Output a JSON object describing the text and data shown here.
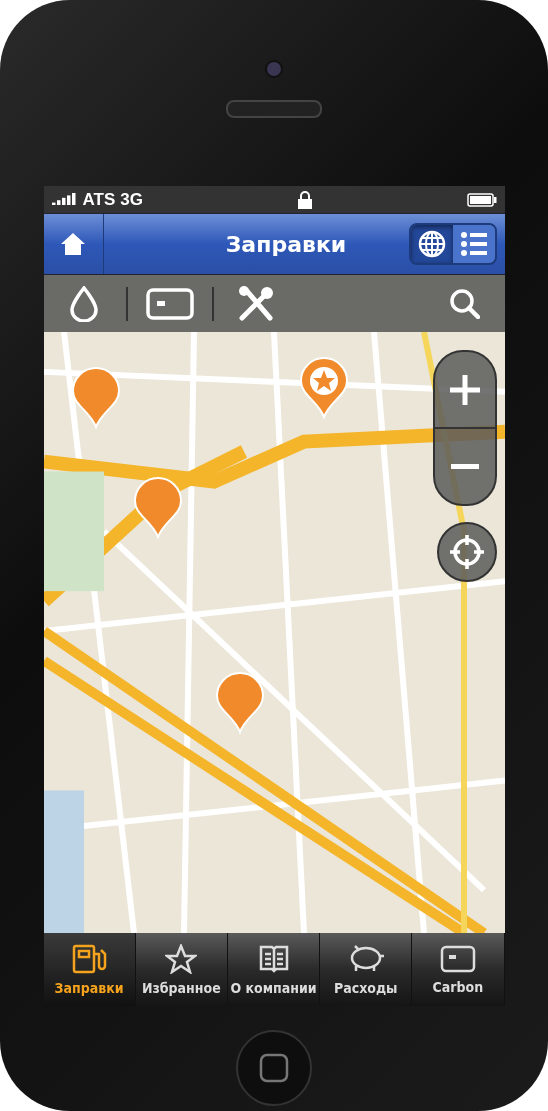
{
  "status_bar": {
    "carrier": "ATS",
    "network": "3G"
  },
  "header": {
    "title": "Заправки",
    "views": [
      {
        "kind": "map",
        "selected": true
      },
      {
        "kind": "list",
        "selected": false
      }
    ]
  },
  "toolbar": {
    "filters": [
      {
        "kind": "fuel"
      },
      {
        "kind": "card"
      },
      {
        "kind": "service"
      }
    ]
  },
  "map": {
    "markers": [
      {
        "kind": "station"
      },
      {
        "kind": "favorite"
      },
      {
        "kind": "station"
      },
      {
        "kind": "station"
      }
    ]
  },
  "tab_bar": [
    {
      "label": "Заправки",
      "kind": "fuel",
      "selected": true
    },
    {
      "label": "Избранное",
      "kind": "star",
      "selected": false
    },
    {
      "label": "О компании",
      "kind": "book",
      "selected": false
    },
    {
      "label": "Расходы",
      "kind": "piggy",
      "selected": false
    },
    {
      "label": "Carbon",
      "kind": "card",
      "selected": false
    }
  ]
}
